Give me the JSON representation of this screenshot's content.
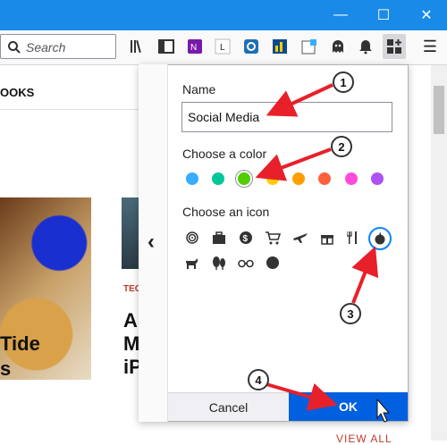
{
  "window": {
    "minimize_glyph": "—",
    "maximize_glyph": "☐",
    "close_glyph": "✕"
  },
  "toolbar": {
    "search_placeholder": "Search",
    "icons": [
      "library-icon",
      "sidebar-icon",
      "onenote-icon",
      "l-extension-icon",
      "screenshot-icon",
      "stats-icon",
      "container-icon",
      "ghostery-icon",
      "bell-icon",
      "containers-icon"
    ],
    "menu_glyph": "☰"
  },
  "page": {
    "section_label": "OOKS",
    "tech_label": "TEC",
    "headline_right": [
      "Ap",
      "M",
      "iP"
    ],
    "headline_left": [
      "Tide",
      "s"
    ],
    "view_all": "VIEW ALL"
  },
  "panel": {
    "back_glyph": "‹",
    "name_label": "Name",
    "name_value": "Social Media",
    "color_label": "Choose a color",
    "colors": [
      "#37adff",
      "#00c79a",
      "#51cd00",
      "#ffcb00",
      "#ff9f00",
      "#ff613d",
      "#ff4bda",
      "#af51f5"
    ],
    "selected_color": "#51cd00",
    "icon_label": "Choose an icon",
    "icon_names": [
      "fingerprint-icon",
      "briefcase-icon",
      "dollar-icon",
      "cart-icon",
      "airplane-icon",
      "gift-icon",
      "food-icon",
      "fruit-icon",
      "pet-icon",
      "tree-icon",
      "glasses-icon",
      "circle-icon"
    ],
    "selected_icon": "fruit-icon",
    "cancel_label": "Cancel",
    "ok_label": "OK"
  },
  "callouts": [
    "1",
    "2",
    "3",
    "4"
  ],
  "accent_colors": {
    "titlebar": "#1a8ae8",
    "ok_button": "#0060df",
    "arrow": "#e8202a"
  }
}
